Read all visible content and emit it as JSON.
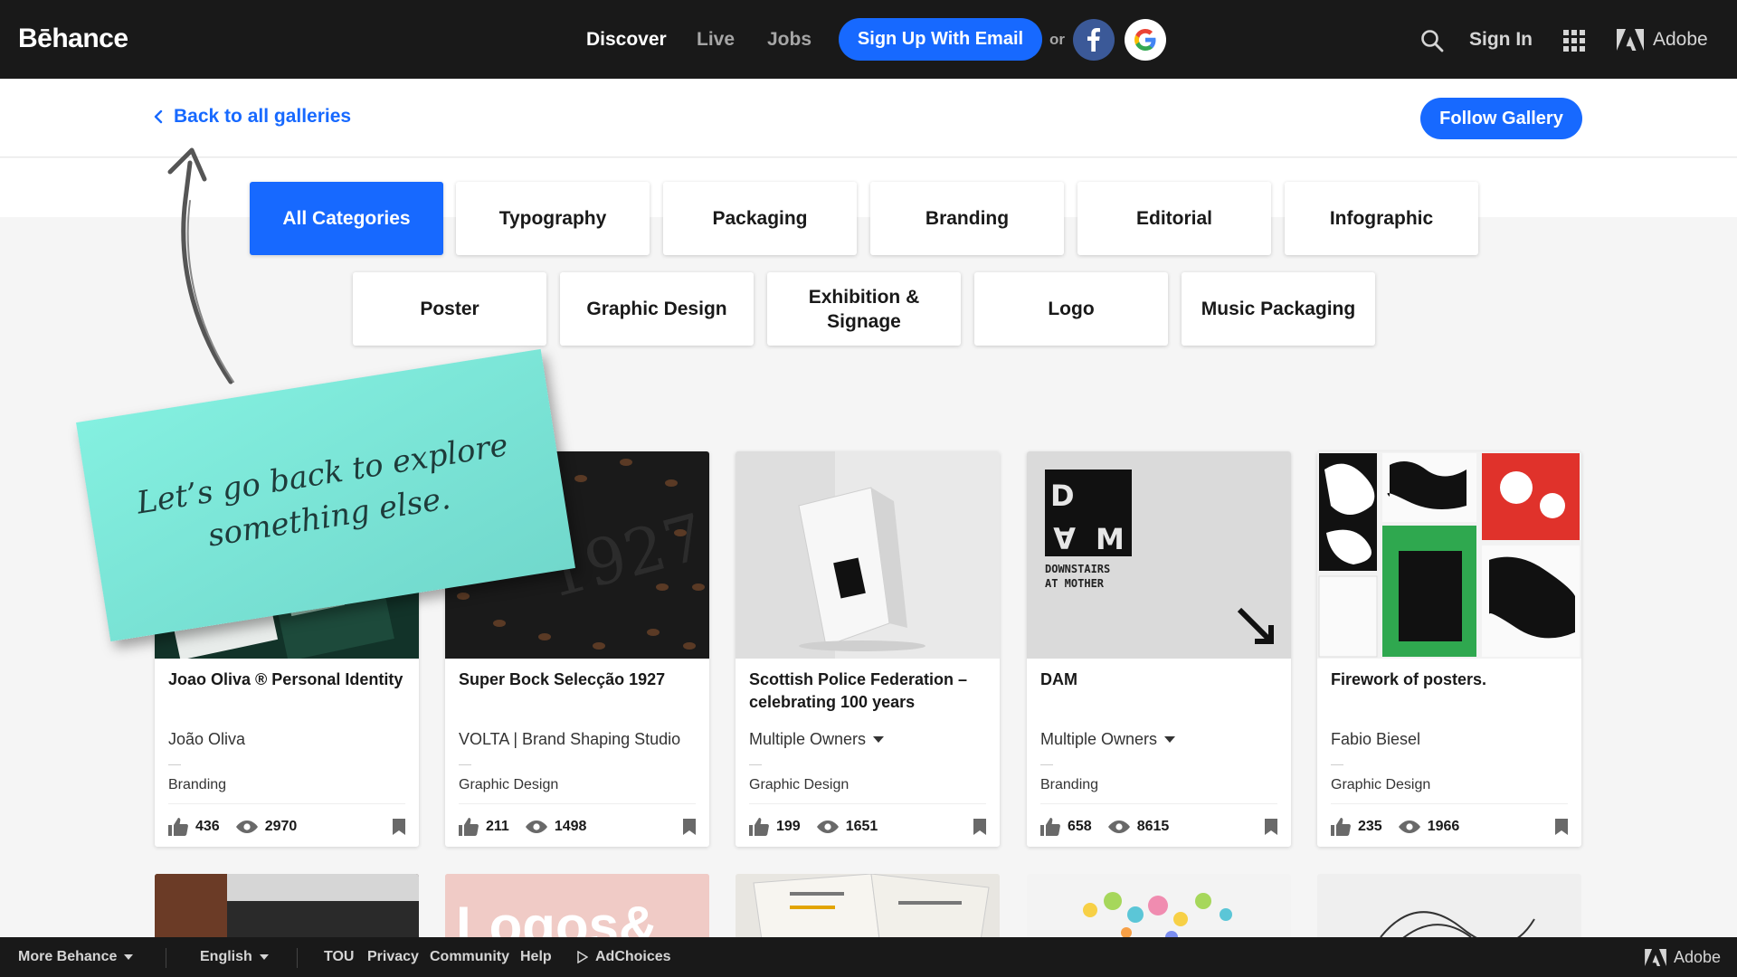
{
  "header": {
    "logo": "Bēhance",
    "nav": [
      "Discover",
      "Live",
      "Jobs"
    ],
    "signup_label": "Sign Up With Email",
    "or_label": "or",
    "signin_label": "Sign In",
    "adobe_label": "Adobe"
  },
  "backbar": {
    "back_label": "Back to all galleries",
    "follow_label": "Follow Gallery"
  },
  "categories": [
    {
      "label": "All Categories",
      "active": true
    },
    {
      "label": "Typography"
    },
    {
      "label": "Packaging"
    },
    {
      "label": "Branding"
    },
    {
      "label": "Editorial"
    },
    {
      "label": "Infographic"
    },
    {
      "label": "Poster"
    },
    {
      "label": "Graphic Design"
    },
    {
      "label": "Exhibition & Signage"
    },
    {
      "label": "Logo"
    },
    {
      "label": "Music Packaging"
    }
  ],
  "note": {
    "text": "Let’s go back to explore something else."
  },
  "projects": [
    {
      "title": "Joao Oliva ® Personal Identity",
      "owner": "João Oliva",
      "field": "Branding",
      "likes": "436",
      "views": "2970"
    },
    {
      "title": "Super Bock Selecção 1927",
      "owner": "VOLTA | Brand Shaping Studio",
      "field": "Graphic Design",
      "likes": "211",
      "views": "1498"
    },
    {
      "title": "Scottish Police Federation – celebrating 100 years",
      "owner": "Multiple Owners",
      "field": "Graphic Design",
      "likes": "199",
      "views": "1651"
    },
    {
      "title": "DAM",
      "owner": "Multiple Owners",
      "field": "Branding",
      "likes": "658",
      "views": "8615"
    },
    {
      "title": "Firework of posters.",
      "owner": "Fabio Biesel",
      "field": "Graphic Design",
      "likes": "235",
      "views": "1966"
    }
  ],
  "thumb_text": {
    "bock_year": "1927",
    "dam_d": "D",
    "dam_a": "A",
    "dam_m": "M",
    "dam_sub1": "DOWNSTAIRS",
    "dam_sub2": "AT MOTHER",
    "logos_text": "Logos&"
  },
  "footer": {
    "more": "More Behance",
    "language": "English",
    "links": [
      "TOU",
      "Privacy",
      "Community",
      "Help"
    ],
    "adchoices": "AdChoices",
    "adobe": "Adobe"
  },
  "colors": {
    "accent": "#1769ff",
    "topbar": "#191919",
    "note": "#7fe6d8"
  }
}
